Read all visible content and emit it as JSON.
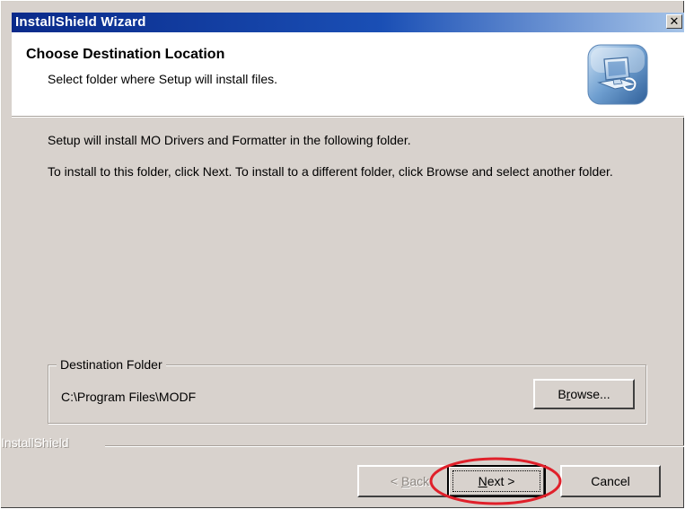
{
  "window": {
    "title": "InstallShield Wizard",
    "close_glyph": "✕"
  },
  "header": {
    "title": "Choose Destination Location",
    "subtitle": "Select folder where Setup will install files.",
    "icon": "setup-computer-icon"
  },
  "body": {
    "line1": "Setup will install MO Drivers and Formatter in the following folder.",
    "line2": "To install to this folder, click Next. To install to a different folder, click Browse and select another folder."
  },
  "destination": {
    "group_label": "Destination Folder",
    "path": "C:\\Program Files\\MODF",
    "browse_label": {
      "pre": "B",
      "accel": "r",
      "post": "owse..."
    }
  },
  "footer": {
    "brand": "InstallShield",
    "back_label": {
      "pre": "< ",
      "accel": "B",
      "post": "ack"
    },
    "next_label": {
      "pre": "",
      "accel": "N",
      "post": "ext >"
    },
    "cancel_label": "Cancel"
  },
  "colors": {
    "title_gradient_start": "#0a2a8a",
    "title_gradient_end": "#a6c4e8",
    "dialog_face": "#d8d2cd",
    "highlight_ellipse": "#e0202a"
  }
}
